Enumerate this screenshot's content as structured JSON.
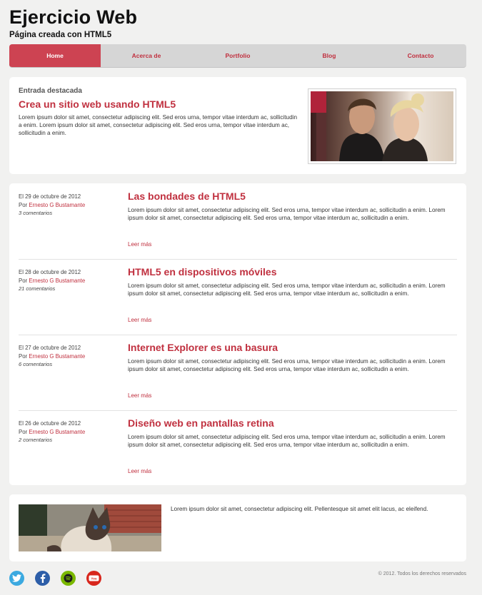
{
  "header": {
    "title": "Ejercicio Web",
    "subtitle": "Página creada con HTML5"
  },
  "nav": {
    "items": [
      {
        "label": "Home",
        "active": true
      },
      {
        "label": "Acerca de"
      },
      {
        "label": "Portfolio"
      },
      {
        "label": "Blog"
      },
      {
        "label": "Contacto"
      }
    ]
  },
  "featured": {
    "label": "Entrada destacada",
    "title": "Crea un sitio web usando HTML5",
    "text": "Lorem ipsum dolor sit amet, consectetur adipiscing elit. Sed eros urna, tempor vitae interdum ac, sollicitudin a enim. Lorem ipsum dolor sit amet, consectetur adipiscing elit. Sed eros urna, tempor vitae interdum ac, sollicitudin a enim."
  },
  "posts": [
    {
      "date": "El 29 de octubre de 2012",
      "author_prefix": "Por ",
      "author": "Ernesto G Bustamante",
      "comments": "3 comentarios",
      "title": "Las bondades de HTML5",
      "text": "Lorem ipsum dolor sit amet, consectetur adipiscing elit. Sed eros urna, tempor vitae interdum ac, sollicitudin a enim. Lorem ipsum dolor sit amet, consectetur adipiscing elit. Sed eros urna, tempor vitae interdum ac, sollicitudin a enim.",
      "more": "Leer más"
    },
    {
      "date": "El 28 de octubre de 2012",
      "author_prefix": "Por ",
      "author": "Ernesto G Bustamante",
      "comments": "21 comentarios",
      "title": "HTML5 en dispositivos móviles",
      "text": "Lorem ipsum dolor sit amet, consectetur adipiscing elit. Sed eros urna, tempor vitae interdum ac, sollicitudin a enim. Lorem ipsum dolor sit amet, consectetur adipiscing elit. Sed eros urna, tempor vitae interdum ac, sollicitudin a enim.",
      "more": "Leer más"
    },
    {
      "date": "El 27 de octubre de 2012",
      "author_prefix": "Por ",
      "author": "Ernesto G Bustamante",
      "comments": "6 comentarios",
      "title": "Internet Explorer es una basura",
      "text": "Lorem ipsum dolor sit amet, consectetur adipiscing elit. Sed eros urna, tempor vitae interdum ac, sollicitudin a enim. Lorem ipsum dolor sit amet, consectetur adipiscing elit. Sed eros urna, tempor vitae interdum ac, sollicitudin a enim.",
      "more": "Leer más"
    },
    {
      "date": "El 26 de octubre de 2012",
      "author_prefix": "Por ",
      "author": "Ernesto G Bustamante",
      "comments": "2 comentarios",
      "title": "Diseño web en pantallas retina",
      "text": "Lorem ipsum dolor sit amet, consectetur adipiscing elit. Sed eros urna, tempor vitae interdum ac, sollicitudin a enim. Lorem ipsum dolor sit amet, consectetur adipiscing elit. Sed eros urna, tempor vitae interdum ac, sollicitudin a enim.",
      "more": "Leer más"
    }
  ],
  "bottom": {
    "text": "Lorem ipsum dolor sit amet, consectetur adipiscing elit. Pellentesque sit amet elit lacus, ac eleifend."
  },
  "footer": {
    "social": [
      {
        "icon": "twitter-icon",
        "color": "#3ba9e0"
      },
      {
        "icon": "facebook-icon",
        "color": "#2d5ea8"
      },
      {
        "icon": "spotify-icon",
        "color": "#7ab800"
      },
      {
        "icon": "youtube-icon",
        "color": "#d8261c"
      }
    ],
    "copyright": "© 2012. Todos los derechos reservados"
  },
  "colors": {
    "accent": "#c0303f",
    "nav_active": "#cd4352",
    "nav_bg": "#d6d6d6",
    "page_bg": "#f1f1f0"
  }
}
